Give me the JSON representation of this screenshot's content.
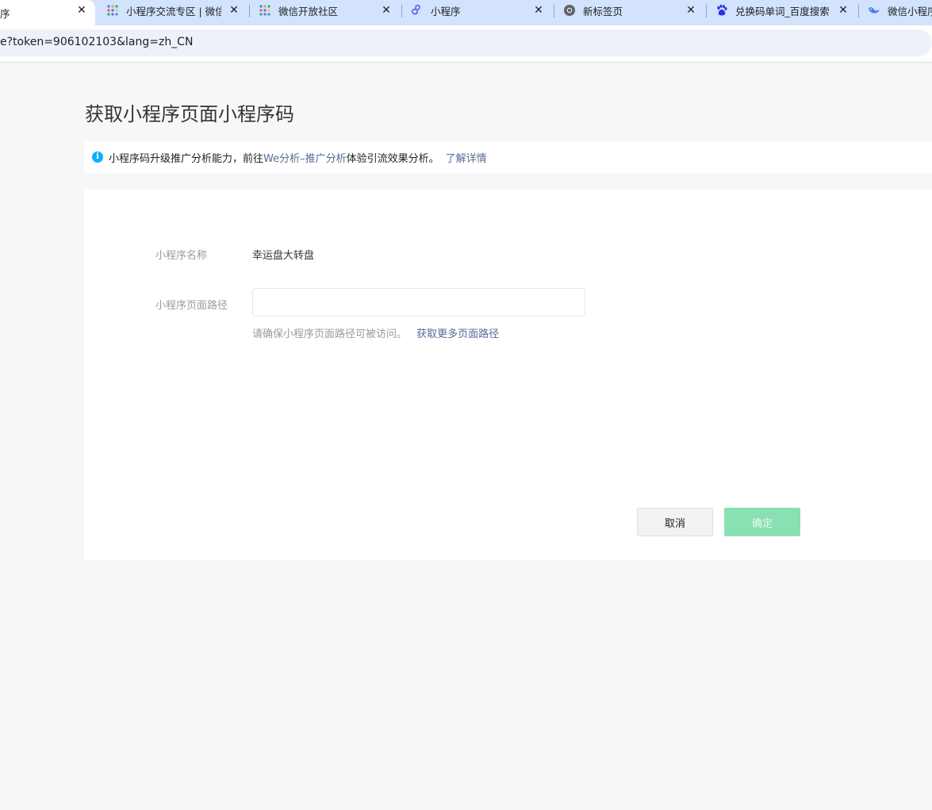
{
  "browser": {
    "tabs": [
      {
        "label": "序",
        "icon": "active-tab-icon",
        "active": true
      },
      {
        "label": "小程序交流专区 | 微信",
        "icon": "wechat-dev-icon"
      },
      {
        "label": "微信开放社区",
        "icon": "wechat-dev-icon"
      },
      {
        "label": "小程序",
        "icon": "miniprogram-icon"
      },
      {
        "label": "新标签页",
        "icon": "chrome-icon"
      },
      {
        "label": "兑换码单词_百度搜索",
        "icon": "baidu-paw-icon"
      },
      {
        "label": "微信小程序",
        "icon": "wechat-bird-icon"
      }
    ],
    "close_glyph": "✕",
    "url": "e?token=906102103&lang=zh_CN"
  },
  "page": {
    "title": "获取小程序页面小程序码",
    "notice": {
      "icon": "info-icon",
      "text_before": "小程序码升级推广分析能力，前往",
      "link": "We分析–推广分析",
      "text_after": "体验引流效果分析。",
      "more_link": "了解详情"
    },
    "form": {
      "name_label": "小程序名称",
      "name_value": "幸运盘大转盘",
      "path_label": "小程序页面路径",
      "path_value": "",
      "path_placeholder": "",
      "hint_text": "请确保小程序页面路径可被访问。",
      "hint_link": "获取更多页面路径"
    },
    "buttons": {
      "cancel": "取消",
      "confirm": "确定"
    }
  },
  "colors": {
    "link": "#576b95",
    "confirm_disabled": "#88e0b3",
    "info": "#10aeff",
    "tabstrip": "#d3e3fd"
  }
}
